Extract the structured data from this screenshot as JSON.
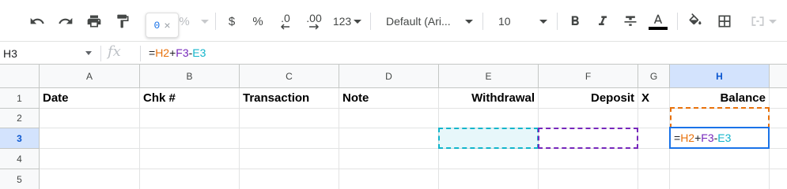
{
  "toolbar": {
    "currency_label": "$",
    "percent_label": "%",
    "decrease_decimal_label": ".0",
    "increase_decimal_label": ".00",
    "more_formats_label": "123",
    "font_family_value": "Default (Ari...",
    "font_size_value": "10",
    "partial_zoom_label": "%",
    "tooltip_value": "0",
    "tooltip_close": "×"
  },
  "formula_bar": {
    "name_box": "H3",
    "fx_label": "fx",
    "formula_parts": [
      "=",
      "H2",
      "+",
      "F3",
      "-",
      "E3"
    ]
  },
  "columns": [
    "A",
    "B",
    "C",
    "D",
    "E",
    "F",
    "G",
    "H"
  ],
  "rows": [
    "1",
    "2",
    "3",
    "4",
    "5"
  ],
  "active_column": "H",
  "active_row": "3",
  "header_row": {
    "date": "Date",
    "chk": "Chk #",
    "transaction": "Transaction",
    "note": "Note",
    "withdrawal": "Withdrawal",
    "deposit": "Deposit",
    "x": "X",
    "balance": "Balance"
  },
  "active_cell": {
    "formula_parts": [
      "=",
      "H2",
      "+",
      "F3",
      "-",
      "E3"
    ]
  },
  "colors": {
    "ref_h2": "#e8710a",
    "ref_f3": "#7627bb",
    "ref_e3": "#12b5cb",
    "selection": "#1a73e8"
  }
}
